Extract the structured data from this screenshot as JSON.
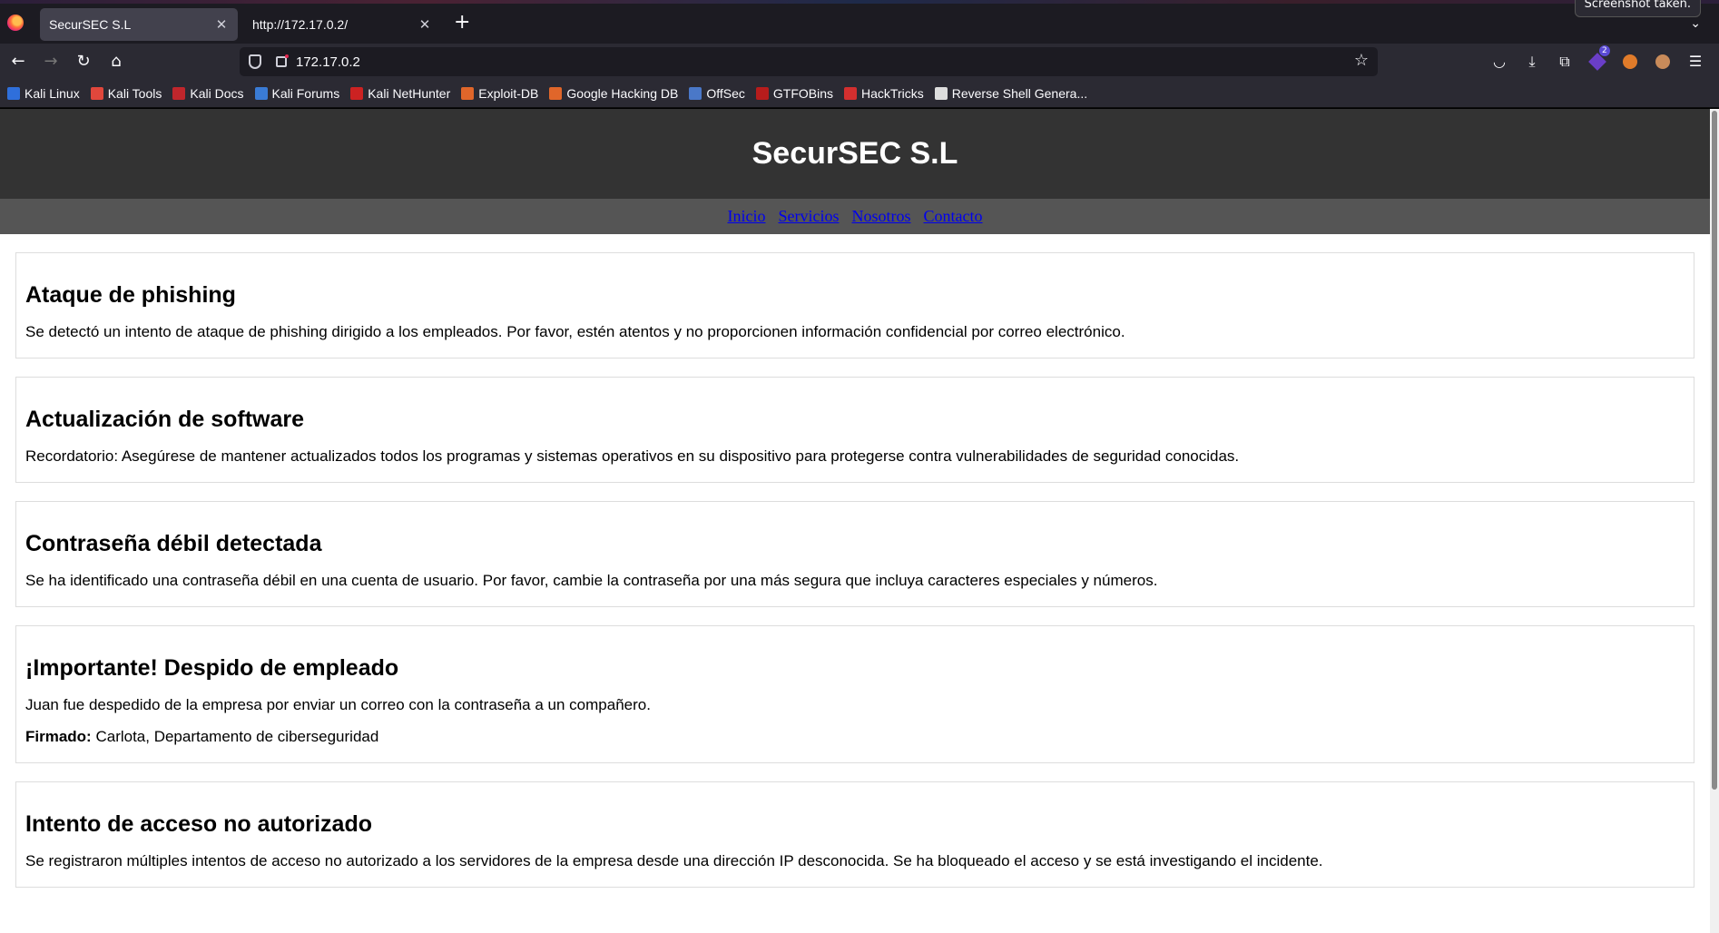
{
  "browser": {
    "tabs": [
      {
        "label": "SecurSEC S.L",
        "active": true
      },
      {
        "label": "http://172.17.0.2/",
        "active": false
      }
    ],
    "notification": "Screenshot taken.",
    "url": "172.17.0.2",
    "extension_badge": "2",
    "bookmarks": [
      {
        "label": "Kali Linux",
        "icon": "kali-icon",
        "color": "#2f6fdb"
      },
      {
        "label": "Kali Tools",
        "icon": "kali-tools-icon",
        "color": "#e0473c"
      },
      {
        "label": "Kali Docs",
        "icon": "kali-docs-icon",
        "color": "#c0262c"
      },
      {
        "label": "Kali Forums",
        "icon": "kali-forums-icon",
        "color": "#3a7bd5"
      },
      {
        "label": "Kali NetHunter",
        "icon": "nethunter-icon",
        "color": "#c22"
      },
      {
        "label": "Exploit-DB",
        "icon": "exploitdb-icon",
        "color": "#e0662a"
      },
      {
        "label": "Google Hacking DB",
        "icon": "ghdb-icon",
        "color": "#e0662a"
      },
      {
        "label": "OffSec",
        "icon": "offsec-icon",
        "color": "#4a78c8"
      },
      {
        "label": "GTFOBins",
        "icon": "gtfobins-icon",
        "color": "#b71c1c"
      },
      {
        "label": "HackTricks",
        "icon": "hacktricks-icon",
        "color": "#d32f2f"
      },
      {
        "label": "Reverse Shell Genera...",
        "icon": "skull-icon",
        "color": "#dddddd"
      }
    ]
  },
  "site": {
    "title": "SecurSEC S.L",
    "nav": [
      "Inicio",
      "Servicios",
      "Nosotros",
      "Contacto"
    ],
    "posts": [
      {
        "heading": "Ataque de phishing",
        "body": "Se detectó un intento de ataque de phishing dirigido a los empleados. Por favor, estén atentos y no proporcionen información confidencial por correo electrónico."
      },
      {
        "heading": "Actualización de software",
        "body": "Recordatorio: Asegúrese de mantener actualizados todos los programas y sistemas operativos en su dispositivo para protegerse contra vulnerabilidades de seguridad conocidas."
      },
      {
        "heading": "Contraseña débil detectada",
        "body": "Se ha identificado una contraseña débil en una cuenta de usuario. Por favor, cambie la contraseña por una más segura que incluya caracteres especiales y números."
      },
      {
        "heading": "¡Importante! Despido de empleado",
        "body": "Juan fue despedido de la empresa por enviar un correo con la contraseña a un compañero.",
        "signature_label": "Firmado:",
        "signature_value": " Carlota, Departamento de ciberseguridad"
      },
      {
        "heading": "Intento de acceso no autorizado",
        "body": "Se registraron múltiples intentos de acceso no autorizado a los servidores de la empresa desde una dirección IP desconocida. Se ha bloqueado el acceso y se está investigando el incidente."
      }
    ]
  }
}
